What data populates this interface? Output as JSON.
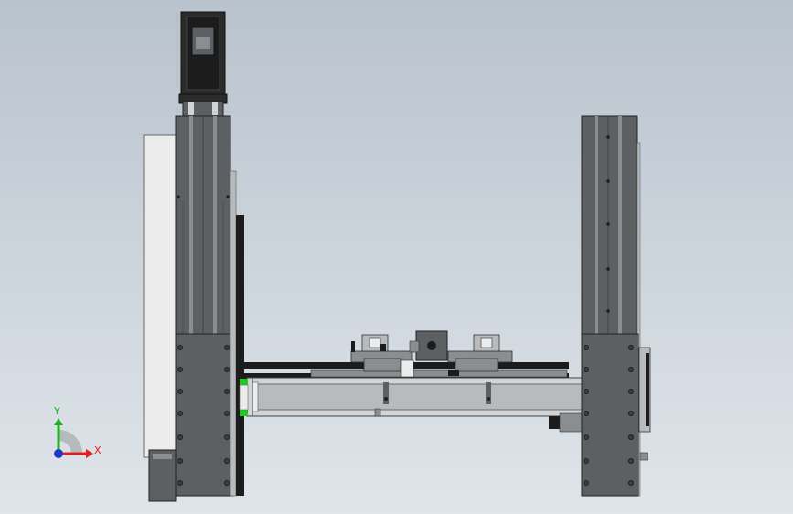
{
  "viewport": {
    "background_top": "#b9c3cd",
    "background_bottom": "#dfe5ea"
  },
  "colors": {
    "steel_dark": "#5d6062",
    "steel_mid": "#8a8e91",
    "steel_light": "#b7bbbd",
    "steel_pale": "#d2d5d6",
    "white_panel": "#ececec",
    "black": "#1c1c1c",
    "motor": "#2b2b2b",
    "accent_green": "#22c922",
    "axis_x": "#e02020",
    "axis_y": "#20b020",
    "axis_z": "#1b3cc8"
  },
  "triad": {
    "x_label": "X",
    "y_label": "Y"
  }
}
